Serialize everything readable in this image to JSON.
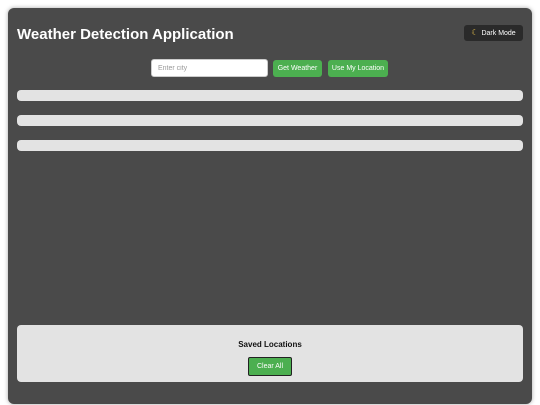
{
  "app": {
    "title": "Weather Detection Application"
  },
  "header": {
    "dark_mode_label": "Dark Mode",
    "dark_mode_icon": "moon-icon"
  },
  "search": {
    "placeholder": "Enter city",
    "value": "",
    "get_weather_label": "Get Weather",
    "use_location_label": "Use My Location"
  },
  "saved_locations": {
    "title": "Saved Locations",
    "clear_all_label": "Clear All"
  },
  "colors": {
    "background": "#4a4a4a",
    "panel": "#e3e3e3",
    "accent_green": "#4caf50",
    "dark_button": "#2a2a2a"
  }
}
